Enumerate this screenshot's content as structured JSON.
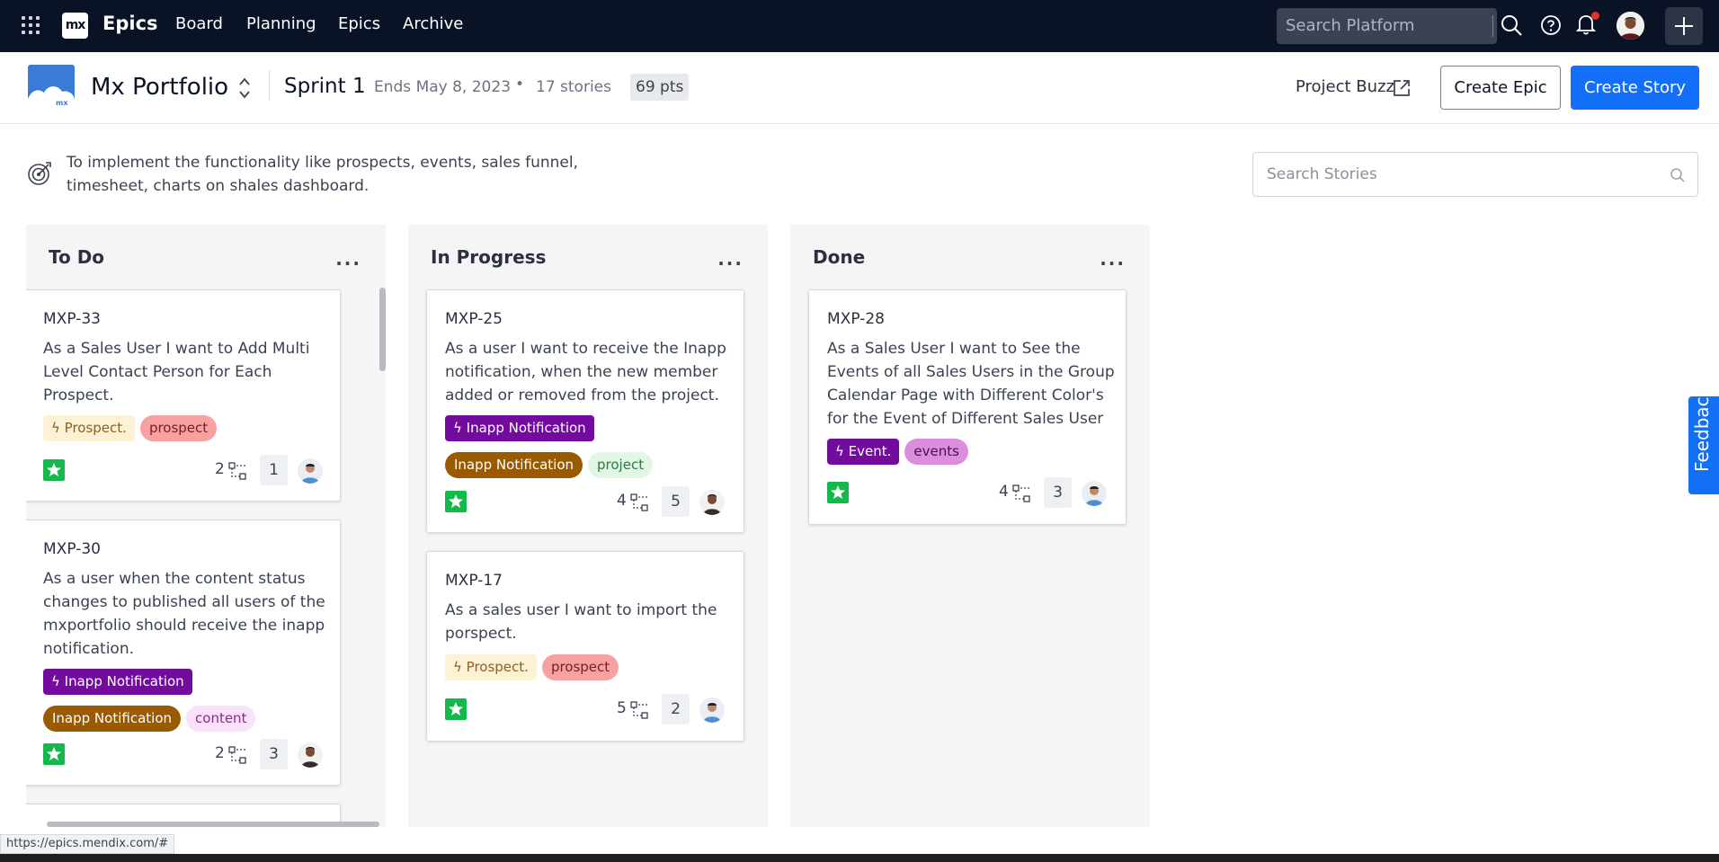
{
  "topnav": {
    "logo_text": "mx",
    "app_name": "Epics",
    "items": [
      "Board",
      "Planning",
      "Epics",
      "Archive"
    ],
    "search_placeholder": "Search Platform"
  },
  "header": {
    "project_name": "Mx Portfolio",
    "sprint_name": "Sprint 1",
    "sprint_end": "Ends May 8, 2023",
    "separator": "•",
    "story_count": "17 stories",
    "points": "69 pts",
    "project_buzz_label": "Project Buzz",
    "create_epic_label": "Create Epic",
    "create_story_label": "Create Story"
  },
  "goal": {
    "text": "To implement the functionality like prospects, events, sales funnel, timesheet, charts on shales dashboard."
  },
  "story_search": {
    "placeholder": "Search Stories"
  },
  "columns": [
    {
      "title": "To Do",
      "more": "···",
      "cards": [
        {
          "id": "MXP-33",
          "title": "As a Sales User I want to Add Multi Level Contact Person for Each Prospect.",
          "epic": "Prospect.",
          "labels": [
            "prospect"
          ],
          "subtasks": "2",
          "points": "1"
        },
        {
          "id": "MXP-30",
          "title": "As a user when the content status changes to published all users of the mxportfolio should receive the inapp notification.",
          "epic": "Inapp Notification",
          "labels": [
            "Inapp Notification",
            "content"
          ],
          "subtasks": "2",
          "points": "3"
        }
      ]
    },
    {
      "title": "In Progress",
      "more": "···",
      "cards": [
        {
          "id": "MXP-25",
          "title": "As a user I want to receive the Inapp notification, when the new member added or removed from the project.",
          "epic": "Inapp Notification",
          "labels": [
            "Inapp Notification",
            "project"
          ],
          "subtasks": "4",
          "points": "5"
        },
        {
          "id": "MXP-17",
          "title": "As a sales user I want to import the porspect.",
          "epic": "Prospect.",
          "labels": [
            "prospect"
          ],
          "subtasks": "5",
          "points": "2"
        }
      ]
    },
    {
      "title": "Done",
      "more": "···",
      "cards": [
        {
          "id": "MXP-28",
          "title": "As a Sales User I want to See the Events of all Sales Users in the Group Calendar Page with Different Color's for the Event of Different Sales User",
          "epic": "Event.",
          "labels": [
            "events"
          ],
          "subtasks": "4",
          "points": "3"
        }
      ]
    }
  ],
  "feedback_label": "Feedback",
  "status_url": "https://epics.mendix.com/#",
  "colors": {
    "nav_bg": "#0a1325",
    "primary": "#146ff8",
    "story_star": "#15b94b",
    "epic_purple": "#730b9e",
    "label_brown": "#9a5a00",
    "label_pink": "#f7a1a1"
  },
  "icons": [
    "apps-grid-icon",
    "search-icon",
    "help-icon",
    "bell-icon",
    "plus-icon",
    "external-link-icon",
    "target-icon",
    "star-icon",
    "subtask-icon",
    "lightning-icon",
    "chevron-updown-icon"
  ]
}
